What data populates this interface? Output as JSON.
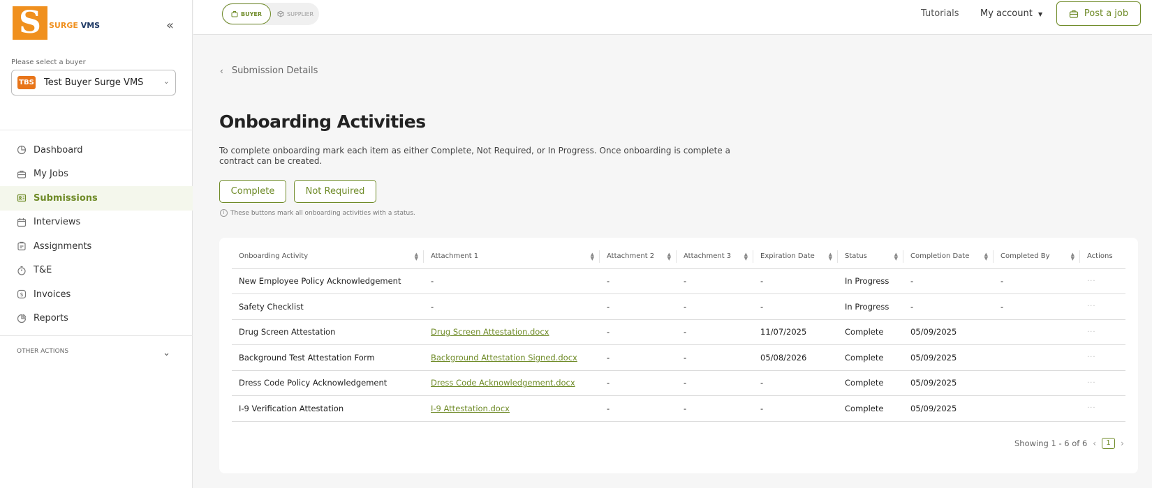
{
  "logo": {
    "letter": "S",
    "brand": "SURGE",
    "suffix": "VMS"
  },
  "buyer": {
    "label": "Please select a buyer",
    "badge": "TBS",
    "name": "Test Buyer Surge VMS"
  },
  "nav": [
    {
      "label": "Dashboard",
      "icon": "pie-chart-icon"
    },
    {
      "label": "My Jobs",
      "icon": "briefcase-icon"
    },
    {
      "label": "Submissions",
      "icon": "id-card-icon",
      "active": true
    },
    {
      "label": "Interviews",
      "icon": "calendar-icon"
    },
    {
      "label": "Assignments",
      "icon": "clipboard-icon"
    },
    {
      "label": "T&E",
      "icon": "stopwatch-icon"
    },
    {
      "label": "Invoices",
      "icon": "dollar-icon"
    },
    {
      "label": "Reports",
      "icon": "report-icon"
    }
  ],
  "other_actions": "OTHER ACTIONS",
  "topbar": {
    "buyer": "BUYER",
    "supplier": "SUPPLIER",
    "tutorials": "Tutorials",
    "my_account": "My account",
    "post_job": "Post a job"
  },
  "main": {
    "back": "Submission Details",
    "title": "Onboarding Activities",
    "description": "To complete onboarding mark each item as either Complete, Not Required, or In Progress. Once onboarding is complete a contract can be created.",
    "complete_btn": "Complete",
    "not_required_btn": "Not Required",
    "hint": "These buttons mark all onboarding activities with a status."
  },
  "table": {
    "columns": [
      "Onboarding Activity",
      "Attachment 1",
      "Attachment 2",
      "Attachment 3",
      "Expiration Date",
      "Status",
      "Completion Date",
      "Completed By",
      "Actions"
    ],
    "rows": [
      [
        "New Employee Policy Acknowledgement",
        "-",
        "-",
        "-",
        "-",
        "In Progress",
        "-",
        "-",
        "···"
      ],
      [
        "Safety Checklist",
        "-",
        "-",
        "-",
        "-",
        "In Progress",
        "-",
        "-",
        "···"
      ],
      [
        "Drug Screen Attestation",
        "Drug Screen Attestation.docx",
        "-",
        "-",
        "11/07/2025",
        "Complete",
        "05/09/2025",
        "",
        "···"
      ],
      [
        "Background Test Attestation Form",
        "Background Attestation Signed.docx",
        "-",
        "-",
        "05/08/2026",
        "Complete",
        "05/09/2025",
        "",
        "···"
      ],
      [
        "Dress Code Policy Acknowledgement",
        "Dress Code Acknowledgement.docx",
        "-",
        "-",
        "-",
        "Complete",
        "05/09/2025",
        "",
        "···"
      ],
      [
        "I-9 Verification Attestation",
        "I-9 Attestation.docx",
        "-",
        "-",
        "-",
        "Complete",
        "05/09/2025",
        "",
        "···"
      ]
    ]
  },
  "pagination": {
    "showing": "Showing 1 - 6 of 6",
    "page": "1"
  },
  "colors": {
    "accent": "#6f8b28",
    "brand_orange": "#f0901e",
    "brand_navy": "#1c3763"
  }
}
